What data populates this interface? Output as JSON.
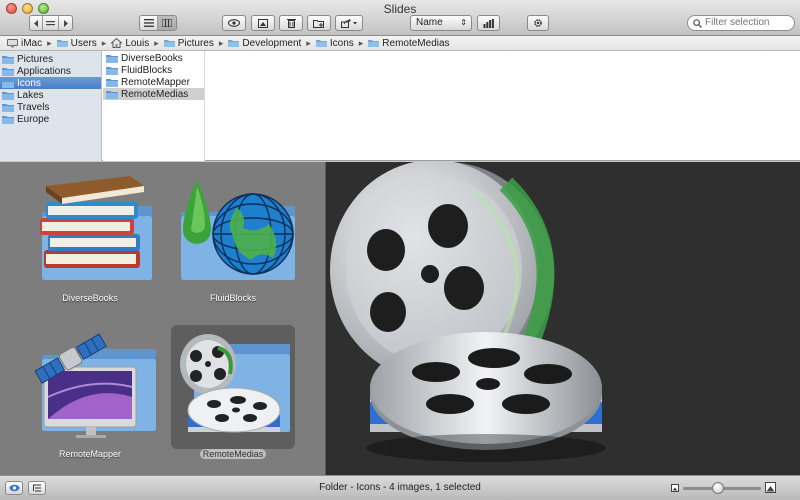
{
  "window": {
    "title": "Slides"
  },
  "toolbar": {
    "sort_value": "Name",
    "search_placeholder": "Filter selection"
  },
  "pathbar": {
    "items": [
      "iMac",
      "Users",
      "Louis",
      "Pictures",
      "Development",
      "Icons",
      "RemoteMedias"
    ]
  },
  "browser": {
    "sidebar": [
      "Pictures",
      "Applications",
      "Icons",
      "Lakes",
      "Travels",
      "Europe"
    ],
    "sidebar_selected": "Icons",
    "column2": [
      "DiverseBooks",
      "FluidBlocks",
      "RemoteMapper",
      "RemoteMedias"
    ],
    "column2_selected": "RemoteMedias"
  },
  "gallery": {
    "items": [
      {
        "label": "DiverseBooks",
        "icon": "books-folder-icon"
      },
      {
        "label": "FluidBlocks",
        "icon": "globe-drop-folder-icon"
      },
      {
        "label": "RemoteMapper",
        "icon": "satellite-monitor-folder-icon"
      },
      {
        "label": "RemoteMedias",
        "icon": "film-reels-folder-icon"
      }
    ],
    "selected": "RemoteMedias"
  },
  "preview": {
    "icon": "film-reels-icon"
  },
  "statusbar": {
    "text": "Folder - Icons - 4 images, 1 selected",
    "zoom_level": 0.45
  },
  "colors": {
    "selection": "#4a7ec9",
    "folder": "#6fa6dc",
    "gallery_bg": "#7d7d7d",
    "preview_bg": "#2f2f2f"
  }
}
